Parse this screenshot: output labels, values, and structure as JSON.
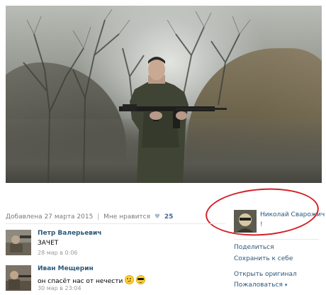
{
  "photo": {
    "description_icon": "photo-soldier"
  },
  "meta": {
    "added": "Добавлена 27 марта 2015",
    "separator": "|",
    "like_label": "Мне нравится",
    "like_count": "25"
  },
  "comments": [
    {
      "author": "Петр Валерьевич",
      "text": "ЗАЧЕТ",
      "time": "28 мар в 0:06"
    },
    {
      "author": "Иван Мещерин",
      "text": "он спасёт нас от нечести",
      "time": "30 мар в 23:04",
      "emojis": [
        "thinking-face",
        "sunglasses-face"
      ]
    }
  ],
  "owner": {
    "name": "Николай Сварожич",
    "mark": "!"
  },
  "sidebar": {
    "links": [
      {
        "label": "Поделиться"
      },
      {
        "label": "Сохранить к себе"
      },
      {
        "label": "Открыть оригинал"
      },
      {
        "label": "Пожаловаться",
        "caret": "▾"
      }
    ]
  },
  "colors": {
    "link": "#2b587a",
    "annotation_circle": "#d52027",
    "meta": "#7a7a7a"
  }
}
